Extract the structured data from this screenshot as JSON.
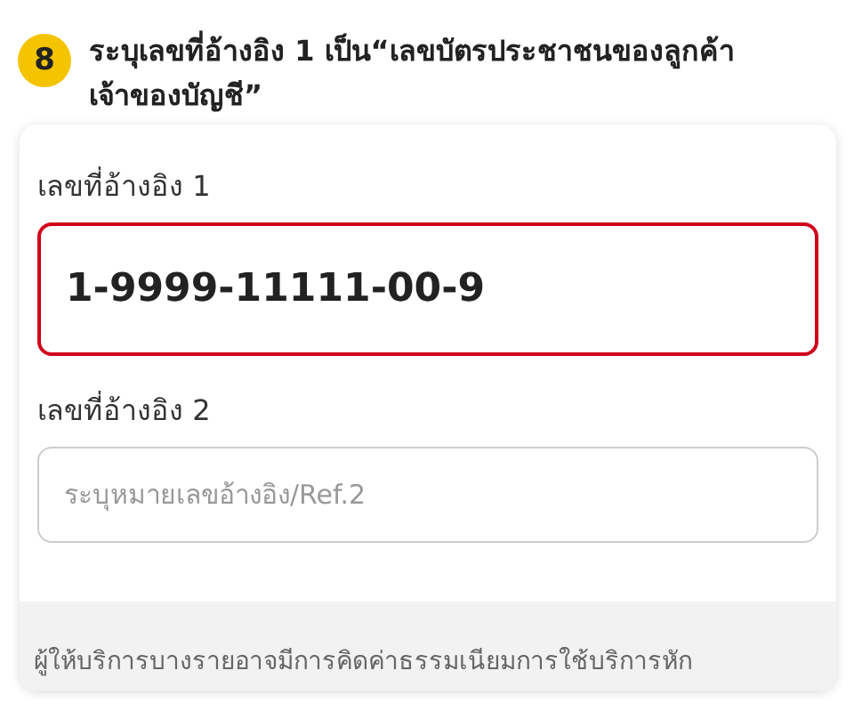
{
  "step": {
    "number": "8",
    "text": "ระบุเลขที่อ้างอิง 1 เป็น“เลขบัตรประชาชนของลูกค้าเจ้าของบัญชี”"
  },
  "fields": [
    {
      "label": "เลขที่อ้างอิง 1",
      "value": "1-9999-11111-00-9",
      "focused": true
    },
    {
      "label": "เลขที่อ้างอิง 2",
      "placeholder": "ระบุหมายเลขอ้างอิง/Ref.2",
      "focused": false
    }
  ],
  "note": "ผู้ให้บริการบางรายอาจมีการคิดค่าธรรมเนียมการใช้บริการหัก"
}
